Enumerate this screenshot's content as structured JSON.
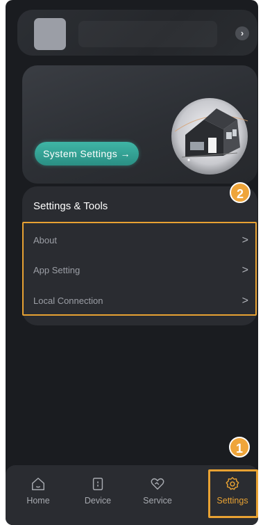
{
  "profile": {
    "arrow_icon": "chevron-right-icon"
  },
  "system_card": {
    "button_label": "System Settings →"
  },
  "tools": {
    "title": "Settings & Tools",
    "items": [
      {
        "label": "About",
        "chevron": ">"
      },
      {
        "label": "App Setting",
        "chevron": ">"
      },
      {
        "label": "Local Connection",
        "chevron": ">"
      }
    ]
  },
  "annotations": {
    "badge_1": "1",
    "badge_2": "2"
  },
  "tabs": [
    {
      "label": "Home",
      "icon": "home-icon"
    },
    {
      "label": "Device",
      "icon": "device-icon"
    },
    {
      "label": "Service",
      "icon": "service-heart-icon"
    },
    {
      "label": "Settings",
      "icon": "settings-gear-icon"
    }
  ],
  "colors": {
    "background": "#1a1c20",
    "card": "#2a2c31",
    "accent_teal": "#3fb5a6",
    "highlight_orange": "#e8a233"
  }
}
